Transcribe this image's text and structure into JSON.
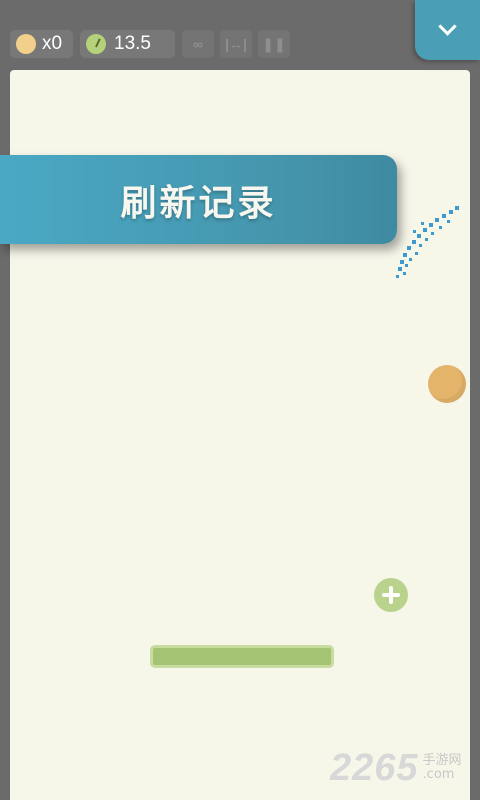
{
  "hud": {
    "coins": "x0",
    "time": "13.5"
  },
  "icons": {
    "coin": "coin-icon",
    "clock": "clock-icon",
    "infinity": "infinity-icon",
    "width": "width-icon",
    "pause": "pause-icon",
    "menu": "chevron-down-icon"
  },
  "banner": {
    "text": "刷新记录"
  },
  "watermark": {
    "number": "2265",
    "site": "手游网",
    "domain": ".com"
  },
  "colors": {
    "accent": "#4a9fb6",
    "board": "#f6f6e9",
    "ball": "#e4b46b",
    "paddle": "#a5c473",
    "particles": "#3b9bd0"
  }
}
